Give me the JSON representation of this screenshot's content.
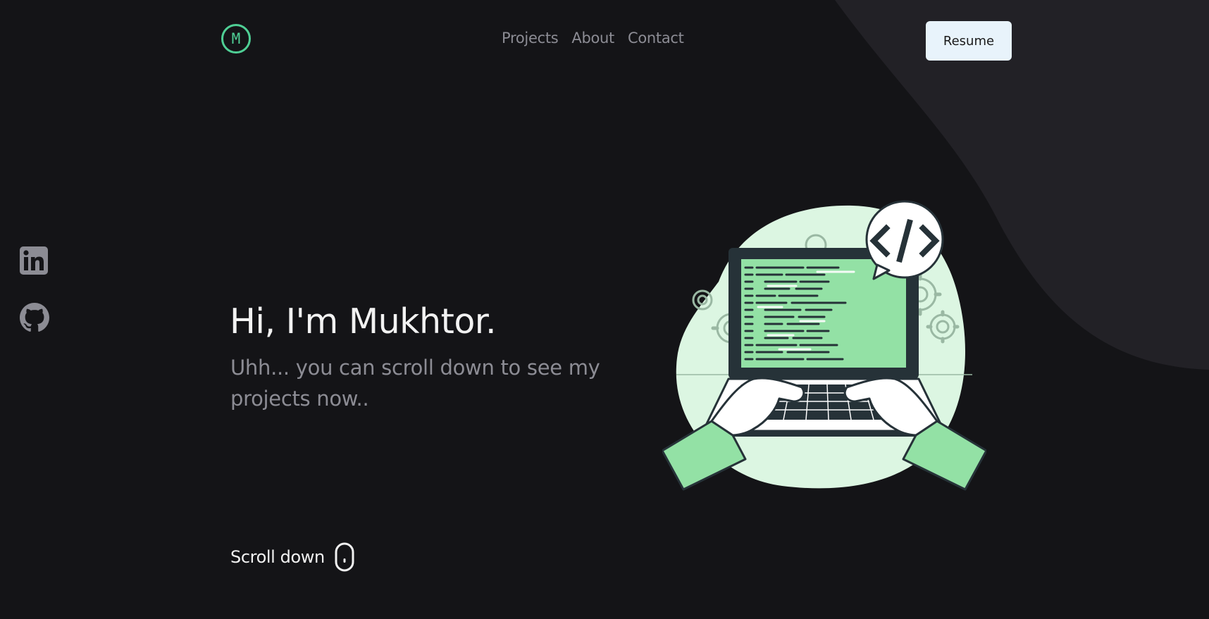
{
  "header": {
    "logo_letter": "M",
    "nav": [
      {
        "label": "Projects"
      },
      {
        "label": "About"
      },
      {
        "label": "Contact"
      }
    ],
    "resume_label": "Resume"
  },
  "social": {
    "linkedin_icon": "linkedin-icon",
    "github_icon": "github-icon"
  },
  "hero": {
    "title": "Hi, I'm Mukhtor.",
    "subtitle": "Uhh... you can scroll down to see my projects now.."
  },
  "scroll": {
    "label": "Scroll down",
    "icon": "mouse-icon"
  },
  "colors": {
    "background": "#141417",
    "background_shape": "#222126",
    "accent": "#4fcf95",
    "illustration_green": "#93e1a5",
    "illustration_light": "#dcf6e2",
    "muted_text": "#8c8c94",
    "button_bg": "#e8f3fb"
  }
}
